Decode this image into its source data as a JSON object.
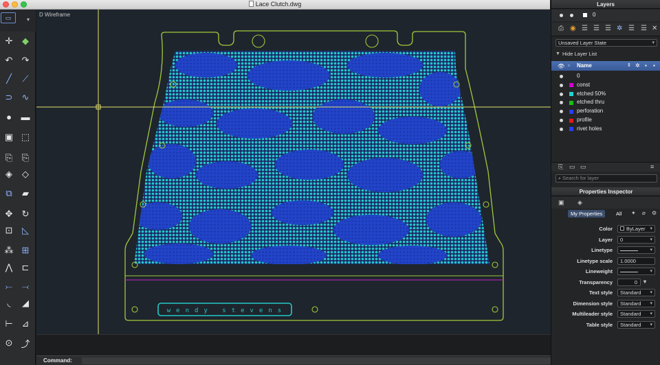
{
  "window": {
    "title": "Lace Clutch.dwg"
  },
  "viewport": {
    "label": "D Wireframe"
  },
  "drawing": {
    "signature": "wendy stevens"
  },
  "command": {
    "label": "Command:",
    "value": ""
  },
  "layers_panel": {
    "title": "Layers",
    "current_layer": "0",
    "layer_state": "Unsaved Layer State",
    "hide_list_label": "Hide Layer List",
    "name_header": "Name",
    "search_placeholder": "Search for layer",
    "layers": [
      {
        "name": "0",
        "color": "#ffffff"
      },
      {
        "name": "const",
        "color": "#d200d2"
      },
      {
        "name": "etched 50%",
        "color": "#22d3d3"
      },
      {
        "name": "etched thru",
        "color": "#18c018"
      },
      {
        "name": "perforation",
        "color": "#2b3cff"
      },
      {
        "name": "profile",
        "color": "#e01a1a"
      },
      {
        "name": "rivet holes",
        "color": "#2b3cff"
      }
    ]
  },
  "properties_panel": {
    "title": "Properties Inspector",
    "tab_my": "My Properties",
    "tab_all": "All",
    "rows": [
      {
        "label": "Color",
        "value": "ByLayer"
      },
      {
        "label": "Layer",
        "value": "0"
      },
      {
        "label": "Linetype",
        "value": ""
      },
      {
        "label": "Linetype scale",
        "value": "1.0000"
      },
      {
        "label": "Lineweight",
        "value": ""
      },
      {
        "label": "Transparency",
        "value": "0"
      },
      {
        "label": "Text style",
        "value": "Standard"
      },
      {
        "label": "Dimension style",
        "value": "Standard"
      },
      {
        "label": "Multileader style",
        "value": "Standard"
      },
      {
        "label": "Table style",
        "value": "Standard"
      }
    ]
  },
  "colors": {
    "canvas_bg": "#1e252d",
    "outline": "#a2c93a",
    "lace_fill": "#1e3ab8",
    "lace_etched": "#24c9c9",
    "crosshair": "#e4e46a",
    "const_line": "#c81fc8"
  }
}
